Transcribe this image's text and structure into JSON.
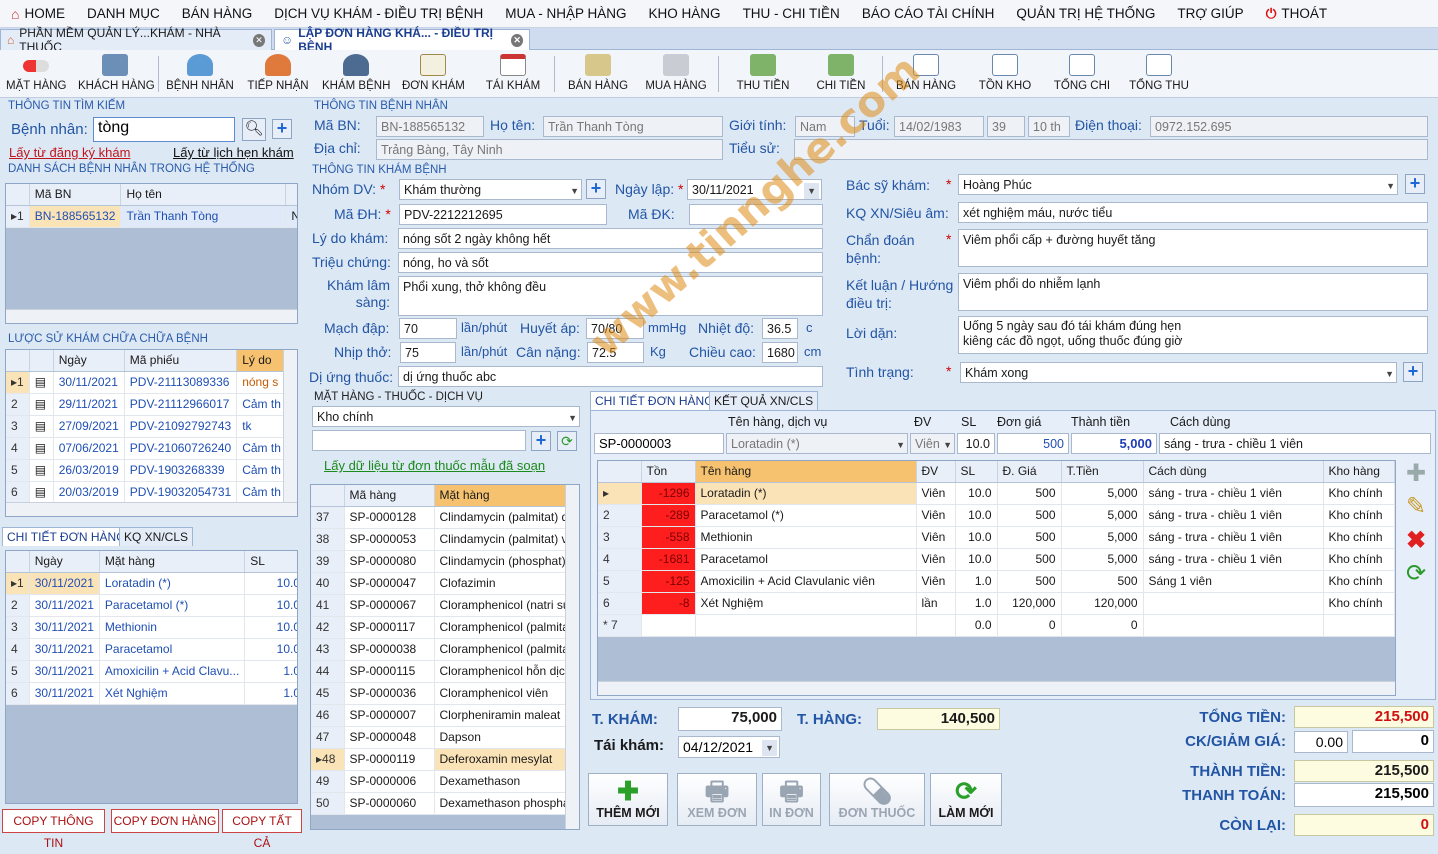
{
  "menu": [
    "HOME",
    "DANH MỤC",
    "BÁN HÀNG",
    "DỊCH VỤ KHÁM - ĐIỀU TRỊ BỆNH",
    "MUA - NHẬP HÀNG",
    "KHO HÀNG",
    "THU - CHI TIỀN",
    "BÁO CÁO TÀI CHÍNH",
    "QUẢN TRỊ HỆ THỐNG",
    "TRỢ GIÚP",
    "THOÁT"
  ],
  "tabs": [
    "PHẦN MỀM QUẢN LÝ...KHÁM - NHÀ THUỐC",
    "LẬP ĐƠN HÀNG KHÁ... - ĐIỀU TRỊ BỆNH"
  ],
  "toolbar": [
    "MẶT HÀNG",
    "KHÁCH HÀNG",
    "BỆNH NHÂN",
    "TIẾP NHẬN",
    "KHÁM BỆNH",
    "ĐƠN KHÁM",
    "TÁI KHÁM",
    "BÁN HÀNG",
    "MUA HÀNG",
    "THU TIỀN",
    "CHI TIỀN",
    "BÁN HÀNG",
    "TỒN KHO",
    "TỔNG CHI",
    "TỔNG THU"
  ],
  "search": {
    "section": "THÔNG TIN TÌM KIẾM",
    "label": "Bệnh nhân:",
    "value": "tòng",
    "link1": "Lấy từ đăng ký khám",
    "link2": "Lấy từ lịch hẹn khám"
  },
  "patient_list": {
    "title": "DANH SÁCH BỆNH NHÂN TRONG HỆ THỐNG",
    "headers": [
      "Mã BN",
      "Họ tên"
    ],
    "rows": [
      [
        "1",
        "BN-188565132",
        "Trần Thanh Tòng",
        "N"
      ]
    ]
  },
  "history": {
    "title": "LƯỢC SỬ KHÁM CHỮA CHỮA BỆNH",
    "headers": [
      "Ngày",
      "Mã phiếu",
      "Lý do"
    ],
    "rows": [
      [
        "1",
        "30/11/2021",
        "PDV-21113089336",
        "nóng s"
      ],
      [
        "2",
        "29/11/2021",
        "PDV-21112966017",
        "Cảm th"
      ],
      [
        "3",
        "27/09/2021",
        "PDV-21092792743",
        "tk"
      ],
      [
        "4",
        "07/06/2021",
        "PDV-21060726240",
        "Cảm th"
      ],
      [
        "5",
        "26/03/2019",
        "PDV-1903268339",
        "Cảm th"
      ],
      [
        "6",
        "20/03/2019",
        "PDV-19032054731",
        "Cảm th"
      ]
    ]
  },
  "left_order": {
    "tabs": [
      "CHI TIẾT ĐƠN HÀNG",
      "KQ XN/CLS"
    ],
    "headers": [
      "Ngày",
      "Mặt hàng",
      "SL"
    ],
    "rows": [
      [
        "1",
        "30/11/2021",
        "Loratadin (*)",
        "10.0"
      ],
      [
        "2",
        "30/11/2021",
        "Paracetamol (*)",
        "10.0"
      ],
      [
        "3",
        "30/11/2021",
        "Methionin",
        "10.0"
      ],
      [
        "4",
        "30/11/2021",
        "Paracetamol",
        "10.0"
      ],
      [
        "5",
        "30/11/2021",
        "Amoxicilin  + Acid Clavu...",
        "1.0"
      ],
      [
        "6",
        "30/11/2021",
        "Xét Nghiệm",
        "1.0"
      ]
    ]
  },
  "bottom_buttons": [
    "COPY THÔNG TIN",
    "COPY ĐƠN HÀNG",
    "COPY TẤT CẢ"
  ],
  "patient": {
    "section": "THÔNG TIN BỆNH NHÂN",
    "ma_bn_label": "Mã BN:",
    "ma_bn": "BN-188565132",
    "ho_ten_label": "Họ tên:",
    "ho_ten": "Trần Thanh Tòng",
    "gioi_tinh_label": "Giới tính:",
    "gioi_tinh": "Nam",
    "tuoi_label": "Tuổi:",
    "ngay_sinh": "14/02/1983",
    "tuoi": "39",
    "thang": "10 th",
    "dien_thoai_label": "Điện thoại:",
    "dien_thoai": "0972.152.695",
    "dia_chi_label": "Địa chỉ:",
    "dia_chi": "Trảng Bàng, Tây Ninh",
    "tieu_su_label": "Tiểu sử:"
  },
  "exam": {
    "section": "THÔNG TIN KHÁM BỆNH",
    "nhom_dv_label": "Nhóm DV:",
    "nhom_dv": "Khám thường",
    "ngay_lap_label": "Ngày lập:",
    "ngay_lap": "30/11/2021",
    "ma_dh_label": "Mã ĐH:",
    "ma_dh": "PDV-2212212695",
    "ma_dk_label": "Mã ĐK:",
    "ly_do_label": "Lý do khám:",
    "ly_do": "nóng sốt 2 ngày không hết",
    "trieu_chung_label": "Triệu chứng:",
    "trieu_chung": "nóng, ho và sốt",
    "kham_ls_label": "Khám lâm sàng:",
    "kham_ls": "Phổi xung, thở không đều",
    "mach_label": "Mạch đập:",
    "mach": "70",
    "mach_unit": "lần/phút",
    "huyet_ap_label": "Huyết áp:",
    "huyet_ap": "70/80",
    "huyet_ap_unit": "mmHg",
    "nhiet_do_label": "Nhiệt độ:",
    "nhiet_do": "36.5",
    "nhiet_do_unit": "c",
    "nhip_tho_label": "Nhịp thở:",
    "nhip_tho": "75",
    "nhip_tho_unit": "lần/phút",
    "can_nang_label": "Cân nặng:",
    "can_nang": "72.5",
    "can_nang_unit": "Kg",
    "chieu_cao_label": "Chiều cao:",
    "chieu_cao": "1680",
    "chieu_cao_unit": "cm",
    "di_ung_label": "Dị ứng thuốc:",
    "di_ung": "dị ứng thuốc abc",
    "bac_si_label": "Bác sỹ khám:",
    "bac_si": "Hoàng Phúc",
    "kq_label": "KQ XN/Siêu âm:",
    "kq": "xét nghiệm máu, nước tiểu",
    "chan_doan_label": "Chẩn đoán bệnh:",
    "chan_doan": "Viêm phổi cấp + đường huyết tăng",
    "ket_luan_label": "Kết luận / Hướng điều trị:",
    "ket_luan": "Viêm phổi do nhiễm lạnh",
    "loi_dan_label": "Lời dặn:",
    "loi_dan_1": "Uống 5 ngày sau đó tái khám đúng hẹn",
    "loi_dan_2": "kiêng các đồ ngọt, uống thuốc đúng giờ",
    "tinh_trang_label": "Tình trạng:",
    "tinh_trang": "Khám xong"
  },
  "goods": {
    "section": "MẶT HÀNG - THUỐC - DỊCH VỤ",
    "kho": "Kho chính",
    "link": "Lấy dữ liệu từ đơn thuốc mẫu đã soạn",
    "headers": [
      "Mã hàng",
      "Mặt hàng"
    ],
    "rows": [
      [
        "37",
        "SP-0000128",
        "Clindamycin (palmitat) dung"
      ],
      [
        "38",
        "SP-0000053",
        "Clindamycin (palmitat) viên"
      ],
      [
        "39",
        "SP-0000080",
        "Clindamycin (phosphat)"
      ],
      [
        "40",
        "SP-0000047",
        "Clofazimin"
      ],
      [
        "41",
        "SP-0000067",
        "Cloramphenicol (natri succi"
      ],
      [
        "42",
        "SP-0000117",
        "Cloramphenicol (palmitat) h"
      ],
      [
        "43",
        "SP-0000038",
        "Cloramphenicol (palmitat) v"
      ],
      [
        "44",
        "SP-0000115",
        "Cloramphenicol hỗn dịch"
      ],
      [
        "45",
        "SP-0000036",
        "Cloramphenicol viên"
      ],
      [
        "46",
        "SP-0000007",
        "Clorpheniramin maleat"
      ],
      [
        "47",
        "SP-0000048",
        "Dapson"
      ],
      [
        "48",
        "SP-0000119",
        "Deferoxamin mesylat"
      ],
      [
        "49",
        "SP-0000006",
        "Dexamethason"
      ],
      [
        "50",
        "SP-0000060",
        "Dexamethason phosphat ("
      ]
    ]
  },
  "order": {
    "tabs": [
      "CHI TIẾT ĐƠN HÀNG",
      "KẾT QUẢ XN/CLS"
    ],
    "entry_headers": [
      "Tên hàng, dịch vụ",
      "ĐV",
      "SL",
      "Đơn giá",
      "Thành tiền",
      "Cách dùng"
    ],
    "entry": {
      "code": "SP-0000003",
      "name": "Loratadin (*)",
      "unit": "Viên",
      "qty": "10.0",
      "price": "500",
      "total": "5,000",
      "usage": "sáng - trưa - chiều 1 viên"
    },
    "headers": [
      "Tồn",
      "Tên hàng",
      "ĐV",
      "SL",
      "Đ. Giá",
      "T.Tiền",
      "Cách dùng",
      "Kho hàng"
    ],
    "rows": [
      [
        "1",
        "-1296",
        "Loratadin (*)",
        "Viên",
        "10.0",
        "500",
        "5,000",
        "sáng - trưa - chiều 1 viên",
        "Kho chính"
      ],
      [
        "2",
        "-289",
        "Paracetamol (*)",
        "Viên",
        "10.0",
        "500",
        "5,000",
        "sáng - trưa - chiều 1 viên",
        "Kho chính"
      ],
      [
        "3",
        "-558",
        "Methionin",
        "Viên",
        "10.0",
        "500",
        "5,000",
        "sáng - trưa - chiều 1 viên",
        "Kho chính"
      ],
      [
        "4",
        "-1681",
        "Paracetamol",
        "Viên",
        "10.0",
        "500",
        "5,000",
        "sáng - trưa - chiều 1 viên",
        "Kho chính"
      ],
      [
        "5",
        "-125",
        "Amoxicilin + Acid Clavulanic viên",
        "Viên",
        "1.0",
        "500",
        "500",
        "Sáng 1 viên",
        "Kho chính"
      ],
      [
        "6",
        "-8",
        "Xét Nghiệm",
        "lần",
        "1.0",
        "120,000",
        "120,000",
        "",
        "Kho chính"
      ],
      [
        "7",
        "",
        "",
        "",
        "0.0",
        "0",
        "0",
        "",
        ""
      ]
    ]
  },
  "totals": {
    "t_kham_label": "T. KHÁM:",
    "t_kham": "75,000",
    "t_hang_label": "T. HÀNG:",
    "t_hang": "140,500",
    "tai_kham_label": "Tái khám:",
    "tai_kham": "04/12/2021",
    "tong_tien_label": "TỔNG TIỀN:",
    "tong_tien": "215,500",
    "ck_label": "CK/GIẢM GIÁ:",
    "ck_pct": "0.00",
    "ck": "0",
    "thanh_tien_label": "THÀNH TIỀN:",
    "thanh_tien": "215,500",
    "thanh_toan_label": "THANH TOÁN:",
    "thanh_toan": "215,500",
    "con_lai_label": "CÒN LẠI:",
    "con_lai": "0"
  },
  "actions": [
    "THÊM MỚI",
    "XEM ĐƠN",
    "IN ĐƠN",
    "ĐƠN THUỐC",
    "LÀM MỚI"
  ],
  "watermark": "www.tinnghe.com",
  "colors": {
    "accent": "#2255a4",
    "negative_stock": "#ff1e1e",
    "selected_header": "#f6c26f"
  }
}
